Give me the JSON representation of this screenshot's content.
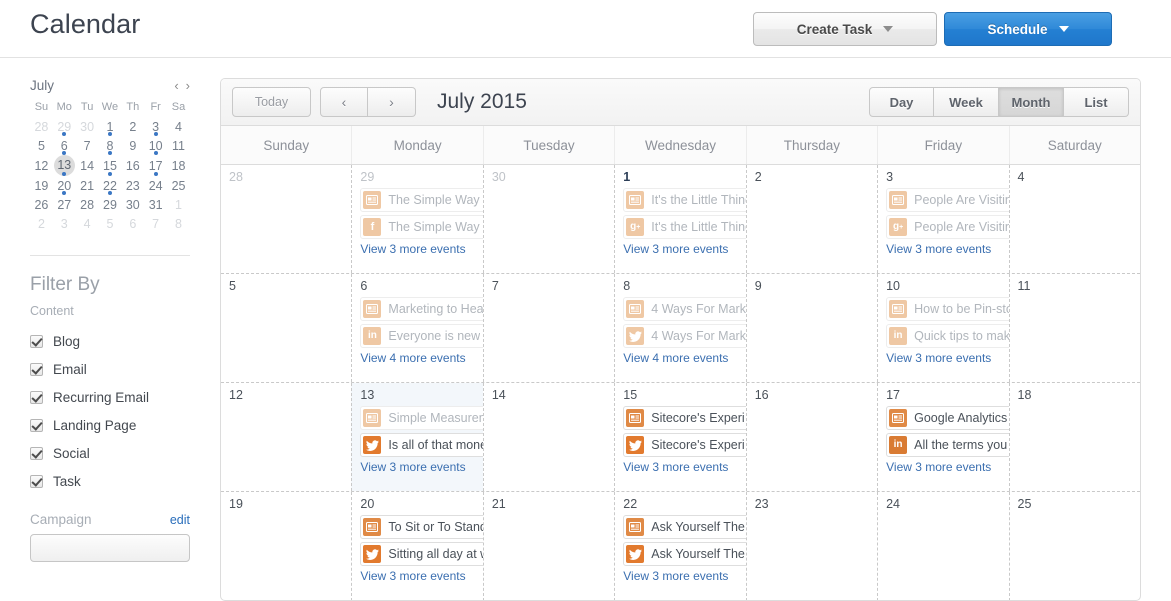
{
  "header": {
    "title": "Calendar",
    "create_task_label": "Create Task",
    "schedule_label": "Schedule"
  },
  "sidebar": {
    "mini_calendar": {
      "month_label": "July",
      "prev_icon": "‹",
      "next_icon": "›",
      "weekday_headers": [
        "Su",
        "Mo",
        "Tu",
        "We",
        "Th",
        "Fr",
        "Sa"
      ],
      "today": 13,
      "dot_days": [
        29,
        1,
        3,
        6,
        8,
        10,
        13,
        15,
        17,
        20,
        22
      ],
      "weeks": [
        [
          {
            "n": "28",
            "out": true
          },
          {
            "n": "29",
            "out": true,
            "dot": true
          },
          {
            "n": "30",
            "out": true
          },
          {
            "n": "1",
            "dot": true
          },
          {
            "n": "2"
          },
          {
            "n": "3",
            "dot": true
          },
          {
            "n": "4"
          }
        ],
        [
          {
            "n": "5"
          },
          {
            "n": "6",
            "dot": true
          },
          {
            "n": "7"
          },
          {
            "n": "8",
            "dot": true
          },
          {
            "n": "9"
          },
          {
            "n": "10",
            "dot": true
          },
          {
            "n": "11"
          }
        ],
        [
          {
            "n": "12"
          },
          {
            "n": "13",
            "dot": true,
            "today": true
          },
          {
            "n": "14"
          },
          {
            "n": "15",
            "dot": true
          },
          {
            "n": "16"
          },
          {
            "n": "17",
            "dot": true
          },
          {
            "n": "18"
          }
        ],
        [
          {
            "n": "19"
          },
          {
            "n": "20",
            "dot": true
          },
          {
            "n": "21"
          },
          {
            "n": "22",
            "dot": true
          },
          {
            "n": "23"
          },
          {
            "n": "24"
          },
          {
            "n": "25"
          }
        ],
        [
          {
            "n": "26"
          },
          {
            "n": "27"
          },
          {
            "n": "28"
          },
          {
            "n": "29"
          },
          {
            "n": "30"
          },
          {
            "n": "31"
          },
          {
            "n": "1",
            "out": true
          }
        ],
        [
          {
            "n": "2",
            "out": true
          },
          {
            "n": "3",
            "out": true
          },
          {
            "n": "4",
            "out": true
          },
          {
            "n": "5",
            "out": true
          },
          {
            "n": "6",
            "out": true
          },
          {
            "n": "7",
            "out": true
          },
          {
            "n": "8",
            "out": true
          }
        ]
      ]
    },
    "filter": {
      "title": "Filter By",
      "content_label": "Content",
      "items": [
        {
          "label": "Blog",
          "checked": true
        },
        {
          "label": "Email",
          "checked": true
        },
        {
          "label": "Recurring Email",
          "checked": true
        },
        {
          "label": "Landing Page",
          "checked": true
        },
        {
          "label": "Social",
          "checked": true
        },
        {
          "label": "Task",
          "checked": true
        }
      ],
      "campaign_label": "Campaign",
      "campaign_edit_label": "edit"
    }
  },
  "calendar": {
    "toolbar": {
      "today_label": "Today",
      "prev_label": "‹",
      "next_label": "›",
      "heading": "July 2015",
      "views": [
        {
          "label": "Day",
          "active": false
        },
        {
          "label": "Week",
          "active": false
        },
        {
          "label": "Month",
          "active": true
        },
        {
          "label": "List",
          "active": false
        }
      ]
    },
    "weekday_headers": [
      "Sunday",
      "Monday",
      "Tuesday",
      "Wednesday",
      "Thursday",
      "Friday",
      "Saturday"
    ],
    "more_text_3": "View 3 more events",
    "more_text_4": "View 4 more events",
    "icon_colors": {
      "blog": "#e08a46",
      "facebook": "#e08a46",
      "googleplus": "#d97b33",
      "twitter": "#e27a2e",
      "linkedin": "#d97b33",
      "muted": "#efc8a4"
    },
    "weeks": [
      [
        {
          "day": "28",
          "other": true,
          "events": [],
          "more": null
        },
        {
          "day": "29",
          "other": true,
          "past": true,
          "events": [
            {
              "icon": "blog-icon",
              "title": "The Simple Way"
            },
            {
              "icon": "facebook-icon",
              "title": "The Simple Way"
            }
          ],
          "more": "View 3 more events"
        },
        {
          "day": "30",
          "other": true,
          "events": [],
          "more": null
        },
        {
          "day": "1",
          "first": true,
          "past": true,
          "events": [
            {
              "icon": "blog-icon",
              "title": "It's the Little Thing"
            },
            {
              "icon": "googleplus-icon",
              "title": "It's the Little Thing"
            }
          ],
          "more": "View 3 more events"
        },
        {
          "day": "2",
          "past": true,
          "events": [],
          "more": null
        },
        {
          "day": "3",
          "past": true,
          "events": [
            {
              "icon": "blog-icon",
              "title": "People Are Visitin"
            },
            {
              "icon": "googleplus-icon",
              "title": "People Are Visitin"
            }
          ],
          "more": "View 3 more events"
        },
        {
          "day": "4",
          "past": true,
          "events": [],
          "more": null
        }
      ],
      [
        {
          "day": "5",
          "past": true,
          "events": [],
          "more": null
        },
        {
          "day": "6",
          "past": true,
          "events": [
            {
              "icon": "blog-icon",
              "title": "Marketing to Hea"
            },
            {
              "icon": "linkedin-icon",
              "title": "Everyone is new"
            }
          ],
          "more": "View 4 more events"
        },
        {
          "day": "7",
          "past": true,
          "events": [],
          "more": null
        },
        {
          "day": "8",
          "past": true,
          "events": [
            {
              "icon": "blog-icon",
              "title": "4 Ways For Mark"
            },
            {
              "icon": "twitter-icon",
              "title": "4 Ways For Mark"
            }
          ],
          "more": "View 4 more events"
        },
        {
          "day": "9",
          "past": true,
          "events": [],
          "more": null
        },
        {
          "day": "10",
          "past": true,
          "events": [
            {
              "icon": "blog-icon",
              "title": "How to be Pin-sto"
            },
            {
              "icon": "linkedin-icon",
              "title": "Quick tips to mak"
            }
          ],
          "more": "View 3 more events"
        },
        {
          "day": "11",
          "past": true,
          "events": [],
          "more": null
        }
      ],
      [
        {
          "day": "12",
          "past": true,
          "events": [],
          "more": null
        },
        {
          "day": "13",
          "today": true,
          "events": [
            {
              "icon": "blog-icon",
              "title": "Simple Measurem",
              "past": true
            },
            {
              "icon": "twitter-icon",
              "title": "Is all of that mone"
            }
          ],
          "more": "View 3 more events"
        },
        {
          "day": "14",
          "events": [],
          "more": null
        },
        {
          "day": "15",
          "events": [
            {
              "icon": "blog-icon",
              "title": "Sitecore's Experi"
            },
            {
              "icon": "twitter-icon",
              "title": "Sitecore's Experi"
            }
          ],
          "more": "View 3 more events"
        },
        {
          "day": "16",
          "events": [],
          "more": null
        },
        {
          "day": "17",
          "events": [
            {
              "icon": "blog-icon",
              "title": "Google Analytics"
            },
            {
              "icon": "linkedin-icon",
              "title": "All the terms you"
            }
          ],
          "more": "View 3 more events"
        },
        {
          "day": "18",
          "events": [],
          "more": null
        }
      ],
      [
        {
          "day": "19",
          "events": [],
          "more": null
        },
        {
          "day": "20",
          "events": [
            {
              "icon": "blog-icon",
              "title": "To Sit or To Stand"
            },
            {
              "icon": "twitter-icon",
              "title": "Sitting all day at w"
            }
          ],
          "more": "View 3 more events"
        },
        {
          "day": "21",
          "events": [],
          "more": null
        },
        {
          "day": "22",
          "events": [
            {
              "icon": "blog-icon",
              "title": "Ask Yourself The"
            },
            {
              "icon": "twitter-icon",
              "title": "Ask Yourself The"
            }
          ],
          "more": "View 3 more events"
        },
        {
          "day": "23",
          "events": [],
          "more": null
        },
        {
          "day": "24",
          "events": [],
          "more": null
        },
        {
          "day": "25",
          "events": [],
          "more": null
        }
      ]
    ]
  }
}
